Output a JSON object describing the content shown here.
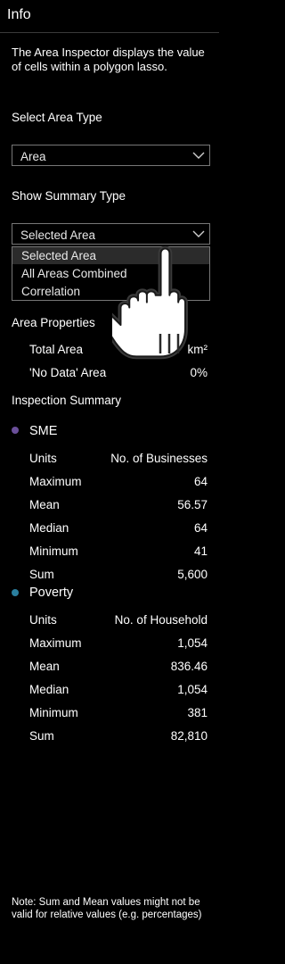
{
  "panel": {
    "title": "Info",
    "description": "The Area Inspector displays the value of cells within a polygon lasso."
  },
  "area_type": {
    "label": "Select Area Type",
    "selected": "Area"
  },
  "summary_type": {
    "label": "Show Summary Type",
    "selected": "Selected Area",
    "options": [
      "Selected Area",
      "All Areas Combined",
      "Correlation"
    ]
  },
  "area_properties": {
    "heading": "Area Properties",
    "rows": [
      {
        "label": "Total Area",
        "value": "km²"
      },
      {
        "label": "'No Data' Area",
        "value": "0%"
      }
    ]
  },
  "inspection_summary": {
    "heading": "Inspection Summary",
    "series": [
      {
        "name": "SME",
        "color": "#6a4f9a",
        "rows": [
          {
            "label": "Units",
            "value": "No. of Businesses"
          },
          {
            "label": "Maximum",
            "value": "64"
          },
          {
            "label": "Mean",
            "value": "56.57"
          },
          {
            "label": "Median",
            "value": "64"
          },
          {
            "label": "Minimum",
            "value": "41"
          },
          {
            "label": "Sum",
            "value": "5,600"
          }
        ]
      },
      {
        "name": "Poverty",
        "color": "#2a7f9e",
        "rows": [
          {
            "label": "Units",
            "value": "No. of Household"
          },
          {
            "label": "Maximum",
            "value": "1,054"
          },
          {
            "label": "Mean",
            "value": "836.46"
          },
          {
            "label": "Median",
            "value": "1,054"
          },
          {
            "label": "Minimum",
            "value": "381"
          },
          {
            "label": "Sum",
            "value": "82,810"
          }
        ]
      }
    ]
  },
  "note": "Note: Sum and Mean values might not be valid for relative values (e.g. percentages)",
  "icons": {
    "chevron": "chevron-down-icon",
    "cursor": "hand-pointer-icon"
  }
}
